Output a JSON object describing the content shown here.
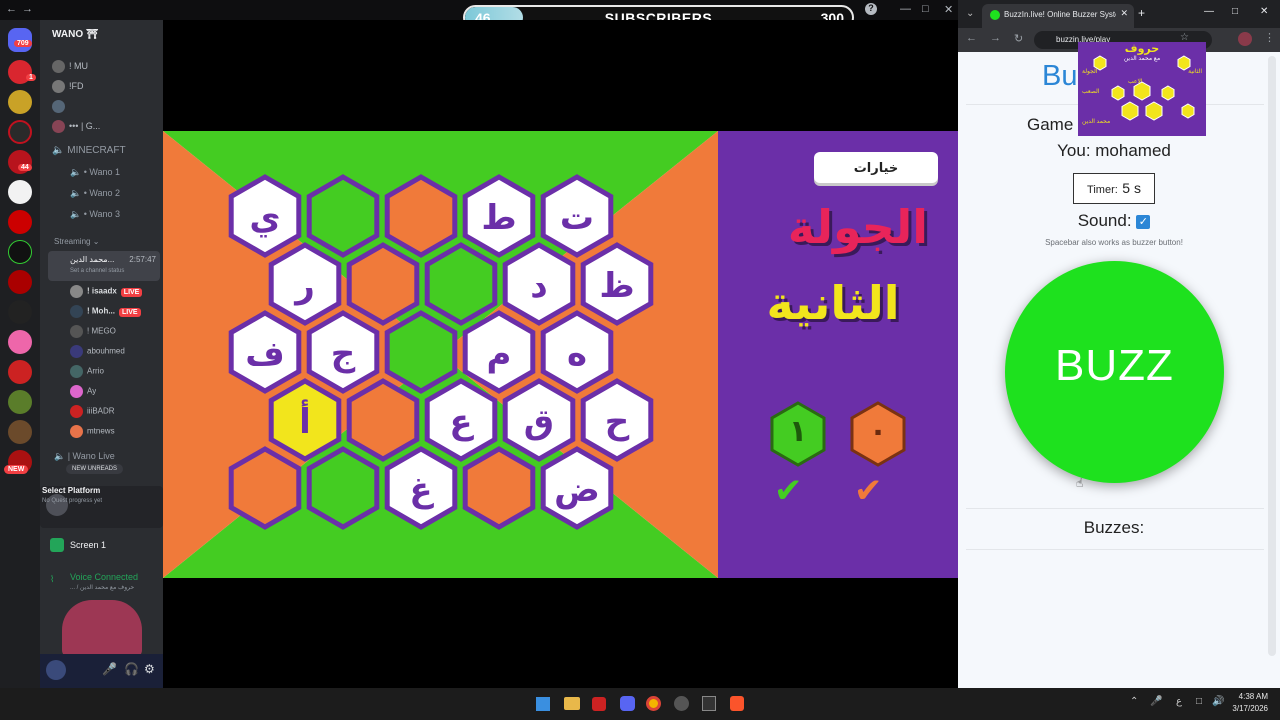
{
  "stream": {
    "subscribers_current": "46",
    "subscribers_goal": "300",
    "subscribers_label": "SUBSCRIBERS",
    "progress": 0.15
  },
  "discord": {
    "server_name": "WANO ⛩",
    "server_badges": [
      "709",
      "1",
      "44"
    ],
    "users_top": [
      "! MU",
      "!FD",
      "",
      "",
      "••• | G..."
    ],
    "category": "MINECRAFT",
    "voice_channels": [
      "Wano 1",
      "Wano 2",
      "Wano 3"
    ],
    "streaming_category": "Streaming",
    "streaming_channel": "محمد الدين...",
    "streaming_time": "2:57:47",
    "channel_status": "Set a channel status",
    "members": [
      {
        "name": "! isaadx",
        "live": "LIVE"
      },
      {
        "name": "! Moh...",
        "live": "LIVE"
      },
      {
        "name": "! MEGO",
        "live": ""
      },
      {
        "name": "abouhmed",
        "live": ""
      },
      {
        "name": "Arrio",
        "live": ""
      },
      {
        "name": "Ay",
        "live": ""
      },
      {
        "name": "iiiBADR",
        "live": ""
      },
      {
        "name": "mtnews",
        "live": ""
      }
    ],
    "wano_live": "| Wano Live",
    "new_unreads": "NEW UNREADS",
    "new_badge": "NEW",
    "select_platform": "Select Platform",
    "quest": "No Quest progress yet",
    "screen": "Screen 1",
    "voice_connected": "Voice Connected",
    "voice_sub": "... / حروف مع محمد الدين"
  },
  "game": {
    "options_label": "خيارات",
    "round_line1": "الجولة",
    "round_line2": "الثانية",
    "score_green": "١",
    "score_orange": "٠",
    "hexes": [
      {
        "t": "ي",
        "c": "w"
      },
      {
        "t": "",
        "c": "g"
      },
      {
        "t": "",
        "c": "o"
      },
      {
        "t": "ط",
        "c": "w"
      },
      {
        "t": "ت",
        "c": "w"
      },
      {
        "t": "ر",
        "c": "w"
      },
      {
        "t": "",
        "c": "o"
      },
      {
        "t": "",
        "c": "g"
      },
      {
        "t": "د",
        "c": "w"
      },
      {
        "t": "ظ",
        "c": "w"
      },
      {
        "t": "ف",
        "c": "w"
      },
      {
        "t": "ج",
        "c": "w"
      },
      {
        "t": "",
        "c": "g"
      },
      {
        "t": "م",
        "c": "w"
      },
      {
        "t": "ه",
        "c": "w"
      },
      {
        "t": "أ",
        "c": "y"
      },
      {
        "t": "",
        "c": "o"
      },
      {
        "t": "ع",
        "c": "w"
      },
      {
        "t": "ق",
        "c": "w"
      },
      {
        "t": "ح",
        "c": "w"
      },
      {
        "t": "",
        "c": "o"
      },
      {
        "t": "",
        "c": "g"
      },
      {
        "t": "غ",
        "c": "w"
      },
      {
        "t": "",
        "c": "o"
      },
      {
        "t": "ض",
        "c": "w"
      }
    ]
  },
  "browser": {
    "tab_title": "BuzzIn.live! Online Buzzer Syste...",
    "url": "buzzin.live/play",
    "heading": "Buz",
    "game_label": "Game",
    "you": "You: mohamed",
    "timer_label": "Timer:",
    "timer_value": "5 s",
    "sound_label": "Sound:",
    "hint": "Spacebar also works as buzzer button!",
    "buzz_label": "BUZZ",
    "buzzes_label": "Buzzes:",
    "overlay_title": "حروف",
    "overlay_sub": "مع محمد الدين",
    "overlay_texts": [
      "الجولة",
      "الثانية",
      "الاعب",
      "الصعب",
      "محمد الدين"
    ]
  },
  "taskbar": {
    "time": "4:38 AM",
    "date": "3/17/2026",
    "lang": "ع"
  },
  "colors": {
    "green": "#44cc22",
    "orange": "#f07a3a",
    "purple": "#6b2fa8",
    "yellow": "#f2e51c",
    "buzz": "#1ee11e"
  }
}
